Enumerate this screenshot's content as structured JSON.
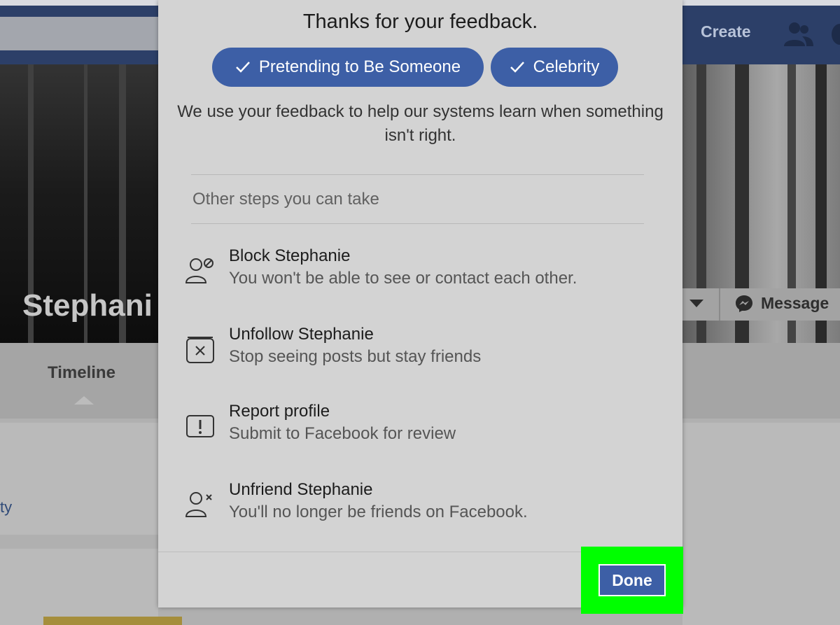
{
  "topbar": {
    "create_label": "Create"
  },
  "profile": {
    "name": "Stephani",
    "message_label": "Message",
    "tab_timeline": "Timeline",
    "left_card_text": "ty"
  },
  "modal": {
    "title": "Thanks for your feedback.",
    "chips": [
      {
        "label": "Pretending to Be Someone"
      },
      {
        "label": "Celebrity"
      }
    ],
    "description": "We use your feedback to help our systems learn when something isn't right.",
    "section_label": "Other steps you can take",
    "options": [
      {
        "icon": "block-person-icon",
        "title": "Block Stephanie",
        "subtitle": "You won't be able to see or contact each other."
      },
      {
        "icon": "unfollow-icon",
        "title": "Unfollow Stephanie",
        "subtitle": "Stop seeing posts but stay friends"
      },
      {
        "icon": "report-icon",
        "title": "Report profile",
        "subtitle": "Submit to Facebook for review"
      },
      {
        "icon": "unfriend-icon",
        "title": "Unfriend Stephanie",
        "subtitle": "You'll no longer be friends on Facebook."
      }
    ],
    "done_label": "Done"
  },
  "colors": {
    "facebook_blue": "#3d5fa6",
    "highlight": "#00ff00",
    "topbar": "#2c3f68"
  }
}
